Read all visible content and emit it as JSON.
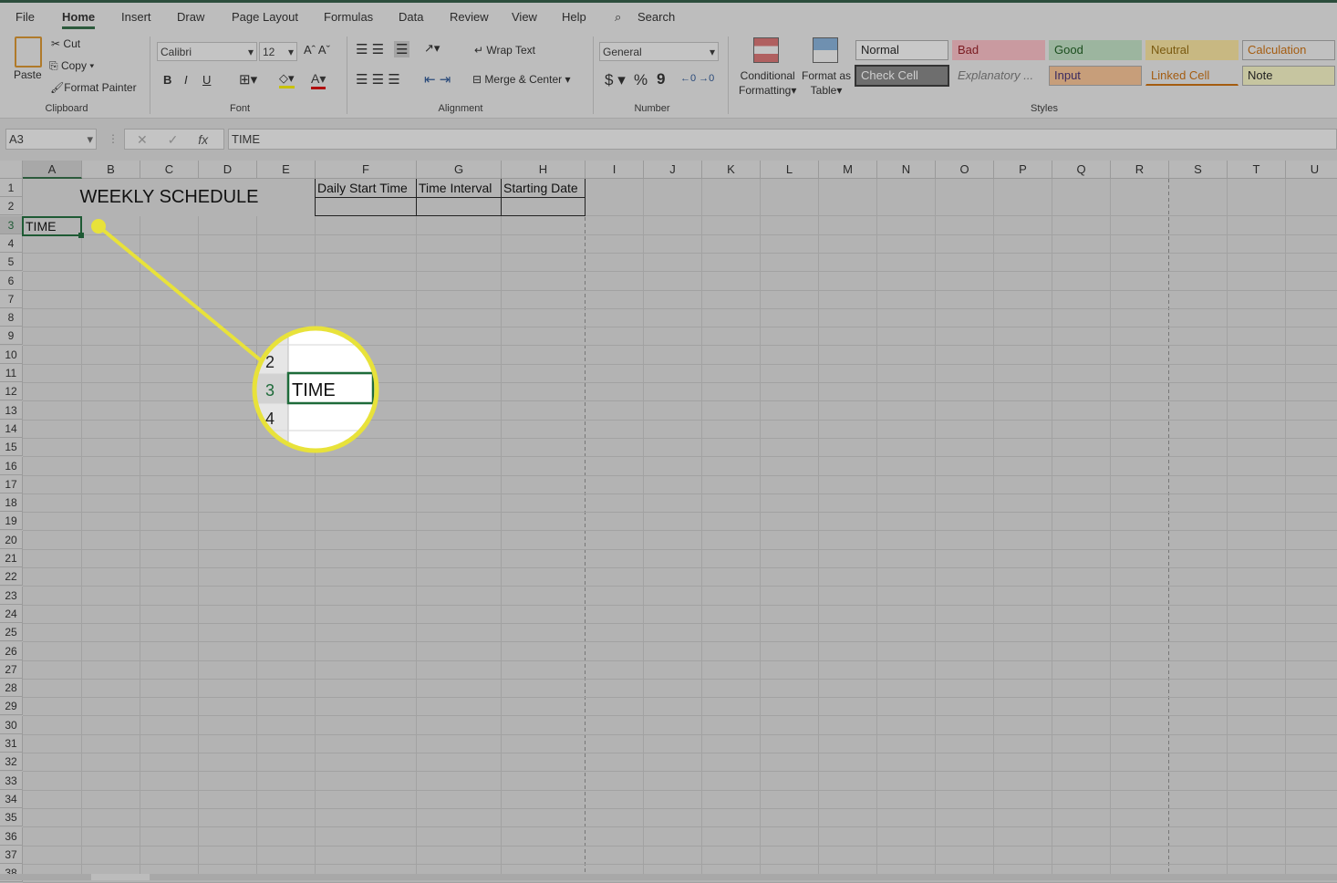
{
  "menu": [
    "File",
    "Home",
    "Insert",
    "Draw",
    "Page Layout",
    "Formulas",
    "Data",
    "Review",
    "View",
    "Help"
  ],
  "search": "Search",
  "clipboard": {
    "paste": "Paste",
    "cut": "Cut",
    "copy": "Copy",
    "format_painter": "Format Painter",
    "group": "Clipboard"
  },
  "font": {
    "name": "Calibri",
    "size": "12",
    "bold": "B",
    "italic": "I",
    "underline": "U",
    "group": "Font"
  },
  "alignment": {
    "wrap": "Wrap Text",
    "merge": "Merge & Center",
    "group": "Alignment"
  },
  "number": {
    "format": "General",
    "currency": "$",
    "percent": "%",
    "comma": "9",
    "group": "Number"
  },
  "styles_group": {
    "conditional": "Conditional",
    "conditional2": "Formatting",
    "table": "Format as",
    "table2": "Table",
    "group": "Styles"
  },
  "styles": [
    {
      "label": "Normal",
      "bg": "#c8c8c8",
      "fg": "#222",
      "border": "#8a8a8a"
    },
    {
      "label": "Bad",
      "bg": "#c99aa0",
      "fg": "#7a1a20",
      "border": "#c99aa0"
    },
    {
      "label": "Good",
      "bg": "#9cb59f",
      "fg": "#1b4e1e",
      "border": "#9cb59f"
    },
    {
      "label": "Neutral",
      "bg": "#c8b882",
      "fg": "#7a5a10",
      "border": "#c8b882"
    },
    {
      "label": "Calculation",
      "bg": "#c0c0c0",
      "fg": "#a45c10",
      "border": "#8a8a8a"
    },
    {
      "label": "Check Cell",
      "bg": "#6e6e6e",
      "fg": "#d0d0d0",
      "border": "#333"
    },
    {
      "label": "Explanatory ...",
      "bg": "#bdbdbd",
      "fg": "#666",
      "border": "#bdbdbd"
    },
    {
      "label": "Input",
      "bg": "#c79e7a",
      "fg": "#3a2a60",
      "border": "#8a8a8a"
    },
    {
      "label": "Linked Cell",
      "bg": "#bdbdbd",
      "fg": "#a45c10",
      "border": "#bdbdbd"
    },
    {
      "label": "Note",
      "bg": "#c6c5a0",
      "fg": "#222",
      "border": "#8a8a8a"
    }
  ],
  "formula_bar": {
    "name_box": "A3",
    "fx": "fx",
    "value": "TIME"
  },
  "columns": [
    "A",
    "B",
    "C",
    "D",
    "E",
    "F",
    "G",
    "H",
    "I",
    "J",
    "K",
    "L",
    "M",
    "N",
    "O",
    "P",
    "Q",
    "R",
    "S",
    "T",
    "U"
  ],
  "rows": 38,
  "cells": {
    "title": "WEEKLY SCHEDULE",
    "f1": "Daily Start Time",
    "g1": "Time Interval",
    "h1": "Starting Date",
    "a3": "TIME"
  },
  "selected_cell": "A3",
  "callout": {
    "rows": [
      "2",
      "3",
      "4"
    ],
    "text": "TIME",
    "color": "#e8e23a"
  }
}
